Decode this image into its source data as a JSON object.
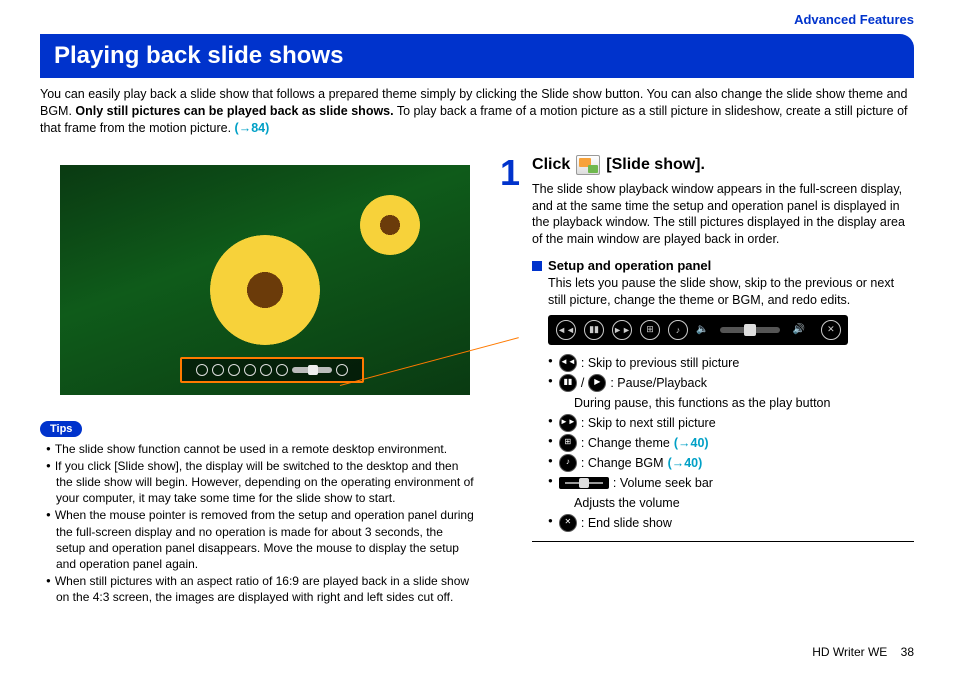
{
  "header": {
    "section": "Advanced Features"
  },
  "title": "Playing back slide shows",
  "intro": {
    "part1": "You can easily play back a slide show that follows a prepared theme simply by clicking the Slide show button. You can also change the slide show theme and BGM. ",
    "bold": "Only still pictures can be played back as slide shows.",
    "part2": " To play back a frame of a motion picture as a still picture in slideshow, create a still picture of that frame from the motion picture. ",
    "ref": "(→84)"
  },
  "tips": {
    "label": "Tips",
    "items": [
      "The slide show function cannot be used in a remote desktop environment.",
      "If you click [Slide show], the display will be switched to the desktop and then the slide show will begin. However, depending on the operating environment of your computer, it may take some time for the slide show to start.",
      "When the mouse pointer is removed from the setup and operation panel during the full-screen display and no operation is made for about 3 seconds, the setup and operation panel disappears. Move the mouse to display the setup and operation panel again.",
      "When still pictures with an aspect ratio of 16:9 are played back in a slide show on the 4:3 screen, the images are displayed with right and left sides cut off."
    ]
  },
  "step": {
    "num": "1",
    "title_pre": "Click",
    "title_post": "[Slide show].",
    "desc": "The slide show playback window appears in the full-screen display, and at the same time the setup and operation panel is displayed in the playback window. The still pictures displayed in the display area of the main window are played back in order.",
    "sub_heading": "Setup and operation panel",
    "sub_desc": "This lets you pause the slide show, skip to the previous or next still picture, change the theme or BGM, and redo edits.",
    "legend": {
      "prev": ": Skip to previous still picture",
      "pause_play": ": Pause/Playback",
      "pause_note": "During pause, this functions as the play button",
      "next": ": Skip to next still picture",
      "theme": ": Change theme ",
      "theme_ref": "(→40)",
      "bgm": ": Change BGM ",
      "bgm_ref": "(→40)",
      "volume": ": Volume seek bar",
      "volume_note": "Adjusts the volume",
      "end": ": End slide show"
    }
  },
  "footer": {
    "product": "HD Writer WE",
    "page": "38"
  }
}
